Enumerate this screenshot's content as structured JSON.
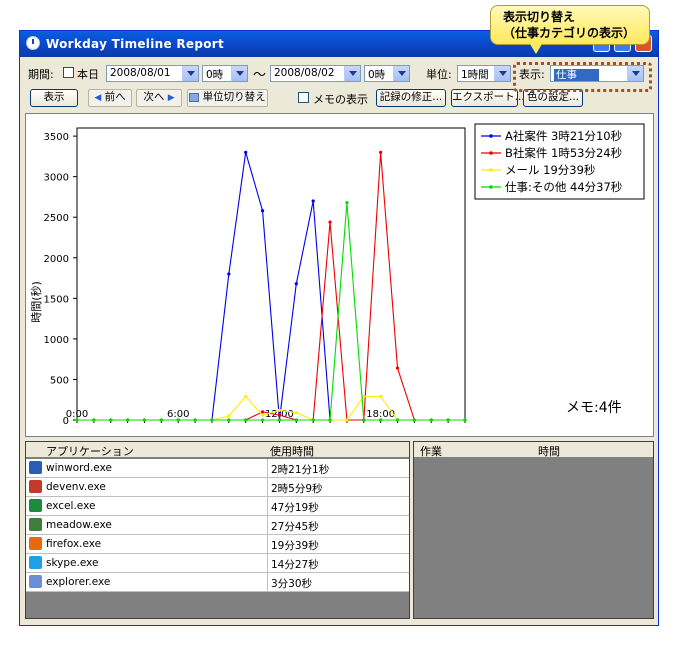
{
  "callout": {
    "line1": "表示切り替え",
    "line2": "（仕事カテゴリの表示）"
  },
  "window": {
    "title": "Workday Timeline Report"
  },
  "toolbar": {
    "period_label": "期間:",
    "today_label": "本日",
    "start_date": "2008/08/01",
    "start_hour": "0時",
    "range_sep": "〜",
    "end_date": "2008/08/02",
    "end_hour": "0時",
    "unit_label": "単位:",
    "unit_value": "1時間",
    "view_label": "表示:",
    "view_value": "仕事",
    "show_button": "表示",
    "prev_button": "前へ",
    "next_button": "次へ",
    "unit_switch_button": "単位切り替え",
    "memo_toggle_label": "メモの表示",
    "edit_records_button": "記録の修正...",
    "export_button": "エクスポート...",
    "color_settings_button": "色の設定..."
  },
  "chart_data": {
    "type": "line",
    "ylabel": "時間(秒)",
    "ylim": [
      0,
      3600
    ],
    "yticks": [
      0,
      500,
      1000,
      1500,
      2000,
      2500,
      3000,
      3500
    ],
    "xtick_labels": [
      "0:00",
      "6:00",
      "12:00",
      "18:00"
    ],
    "xlim": [
      0,
      23
    ],
    "x": [
      0,
      1,
      2,
      3,
      4,
      5,
      6,
      7,
      8,
      9,
      10,
      11,
      12,
      13,
      14,
      15,
      16,
      17,
      18,
      19,
      20,
      21,
      22,
      23
    ],
    "series": [
      {
        "name": "A社案件 3時21分10秒",
        "color": "#0000ee",
        "values": [
          0,
          0,
          0,
          0,
          0,
          0,
          0,
          0,
          0,
          1800,
          3300,
          2580,
          0,
          1680,
          2700,
          0,
          0,
          0,
          0,
          0,
          0,
          0,
          0,
          0
        ]
      },
      {
        "name": "B社案件 1時53分24秒",
        "color": "#ee0000",
        "values": [
          0,
          0,
          0,
          0,
          0,
          0,
          0,
          0,
          0,
          0,
          0,
          100,
          60,
          0,
          0,
          2440,
          0,
          0,
          3300,
          640,
          0,
          0,
          0,
          0
        ]
      },
      {
        "name": "メール 19分39秒",
        "color": "#ffee00",
        "values": [
          0,
          0,
          0,
          0,
          0,
          0,
          0,
          0,
          0,
          50,
          290,
          60,
          120,
          90,
          0,
          0,
          0,
          290,
          290,
          0,
          0,
          0,
          0,
          0
        ]
      },
      {
        "name": "仕事:その他 44分37秒",
        "color": "#00dd00",
        "values": [
          0,
          0,
          0,
          0,
          0,
          0,
          0,
          0,
          0,
          0,
          0,
          0,
          0,
          0,
          0,
          0,
          2680,
          0,
          0,
          0,
          0,
          0,
          0,
          0
        ]
      }
    ],
    "legend_position": "top-right",
    "annotation": "メモ:4件"
  },
  "apps": {
    "headers": [
      "アプリケーション",
      "使用時間"
    ],
    "rows": [
      {
        "name": "winword.exe",
        "time": "2時21分1秒",
        "icon": "word-icon",
        "color": "#2b5bb8"
      },
      {
        "name": "devenv.exe",
        "time": "2時5分9秒",
        "icon": "visual-studio-icon",
        "color": "#c0392b"
      },
      {
        "name": "excel.exe",
        "time": "47分19秒",
        "icon": "excel-icon",
        "color": "#1e8a3c"
      },
      {
        "name": "meadow.exe",
        "time": "27分45秒",
        "icon": "meadow-icon",
        "color": "#3f7d3a"
      },
      {
        "name": "firefox.exe",
        "time": "19分39秒",
        "icon": "firefox-icon",
        "color": "#e66a13"
      },
      {
        "name": "skype.exe",
        "time": "14分27秒",
        "icon": "skype-icon",
        "color": "#1fa0e6"
      },
      {
        "name": "explorer.exe",
        "time": "3分30秒",
        "icon": "explorer-icon",
        "color": "#6b8fd6"
      }
    ]
  },
  "tasks": {
    "headers": [
      "作業",
      "時間"
    ]
  }
}
